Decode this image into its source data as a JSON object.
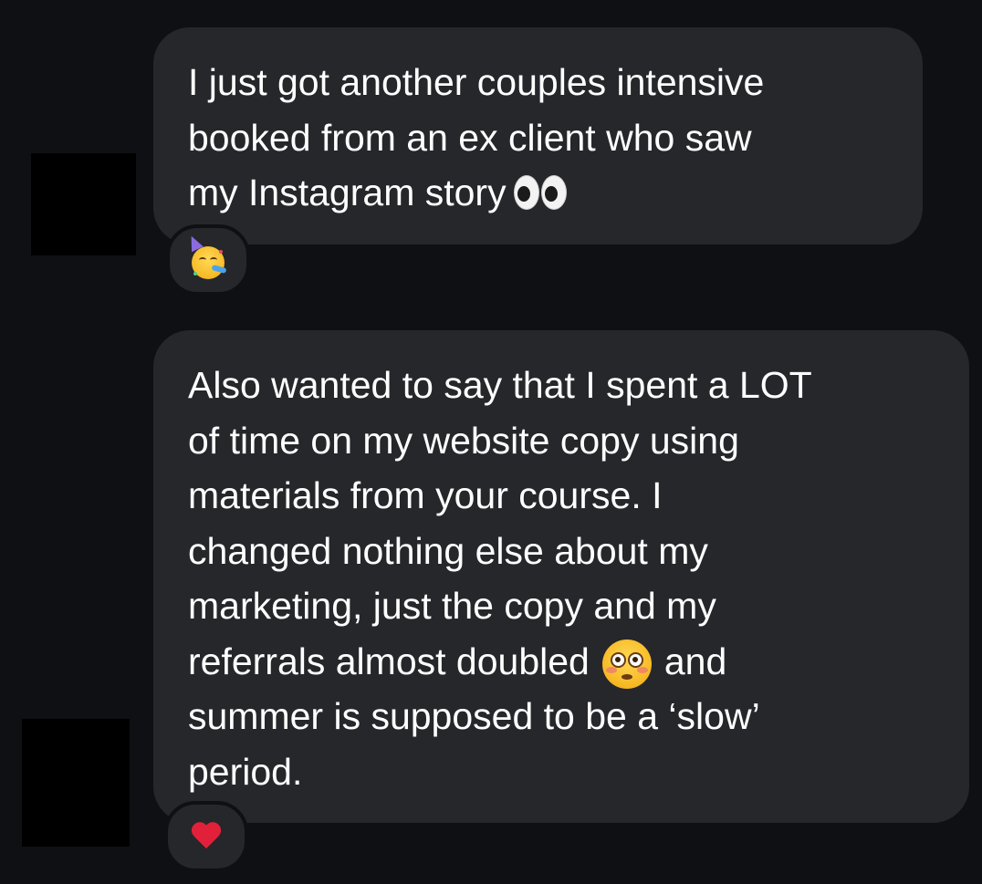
{
  "messages": [
    {
      "lines": [
        "I just got another couples intensive",
        "booked from an ex client who saw",
        "my Instagram story"
      ],
      "inline_emoji": "eyes-emoji",
      "reaction": "partying-face-emoji"
    },
    {
      "lines": [
        "Also wanted to say that I spent a LOT",
        "of time on my website copy using",
        "materials from your course. I",
        "changed nothing else about my",
        "marketing, just the copy and my",
        "referrals almost doubled",
        "and",
        "summer is supposed to be a ‘slow’",
        "period."
      ],
      "inline_emoji": "flushed-face-emoji",
      "reaction": "red-heart-emoji"
    }
  ],
  "colors": {
    "background": "#0f1014",
    "bubble": "#26272b",
    "text": "#ffffff",
    "heart": "#e3203a"
  }
}
